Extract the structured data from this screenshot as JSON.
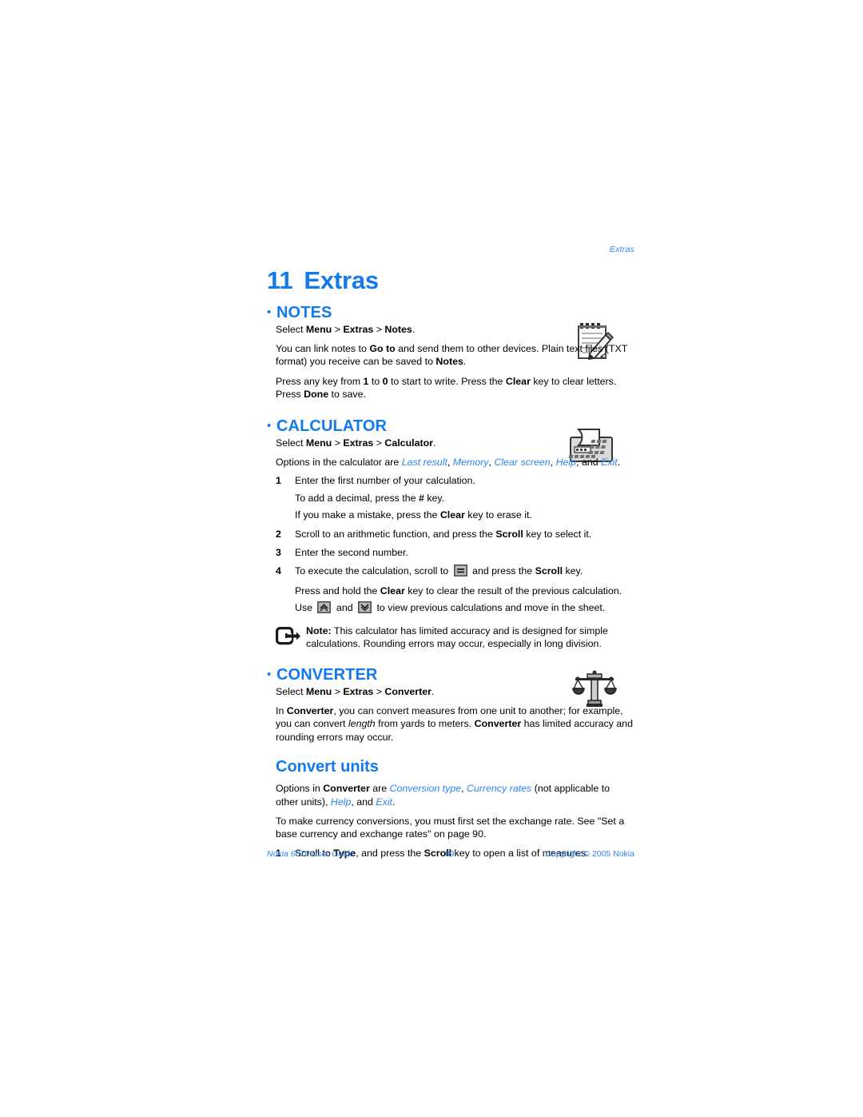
{
  "page": {
    "running_head": "Extras",
    "chapter_number": "11",
    "chapter_title": "Extras",
    "accent_color": "#1279ee",
    "link_color": "#2e86f0"
  },
  "notes": {
    "heading": "NOTES",
    "icon": "notepad-pencil-icon",
    "select_path_prefix": "Select ",
    "select_menu": "Menu",
    "sep1": " > ",
    "select_extras": "Extras",
    "sep2": " > ",
    "select_leaf": "Notes",
    "select_period": ".",
    "para1_a": "You can link notes to ",
    "para1_b": "Go to",
    "para1_c": " and send them to other devices. Plain text files (TXT format) you receive can be saved to ",
    "para1_d": "Notes",
    "para1_e": ".",
    "para2_a": "Press any key from ",
    "para2_b": "1",
    "para2_c": " to ",
    "para2_d": "0",
    "para2_e": " to start to write. Press the ",
    "para2_f": "Clear",
    "para2_g": " key to clear letters. Press ",
    "para2_h": "Done",
    "para2_i": " to save."
  },
  "calculator": {
    "heading": "CALCULATOR",
    "icon": "calculator-adding-machine-icon",
    "select_path_prefix": "Select ",
    "select_menu": "Menu",
    "sep1": " > ",
    "select_extras": "Extras",
    "sep2": " > ",
    "select_leaf": "Calculator",
    "select_period": ".",
    "options_lead": "Options in the calculator are ",
    "options": [
      "Last result",
      "Memory",
      "Clear screen",
      "Help",
      "Exit"
    ],
    "options_comma": ", ",
    "options_and": ", and ",
    "options_period": ".",
    "steps": [
      {
        "n": "1",
        "text": "Enter the first number of your calculation.",
        "subs": [
          {
            "a": "To add a decimal, press the ",
            "b": "#",
            "c": " key."
          },
          {
            "a": "If you make a mistake, press the ",
            "b": "Clear",
            "c": " key to erase it."
          }
        ]
      },
      {
        "n": "2",
        "a": "Scroll to an arithmetic function, and press the ",
        "b": "Scroll",
        "c": " key to select it."
      },
      {
        "n": "3",
        "text": "Enter the second number."
      },
      {
        "n": "4",
        "a": "To execute the calculation, scroll to ",
        "icon": "equals-key-icon",
        "b": " and press the ",
        "c": "Scroll",
        "d": " key."
      }
    ],
    "after_a": "Press and hold the ",
    "after_b": "Clear",
    "after_c": " key to clear the result of the previous calculation.",
    "use_a": "Use ",
    "use_icon_up": "scroll-up-key-icon",
    "use_and": " and ",
    "use_icon_down": "scroll-down-key-icon",
    "use_b": " to view previous calculations and move in the sheet.",
    "note_icon": "note-callout-icon",
    "note_label": "Note:",
    "note_text": " This calculator has limited accuracy and is designed for simple calculations. Rounding errors may occur, especially in long division."
  },
  "converter": {
    "heading": "CONVERTER",
    "icon": "balance-scale-icon",
    "select_path_prefix": "Select ",
    "select_menu": "Menu",
    "sep1": " > ",
    "select_extras": "Extras",
    "sep2": " > ",
    "select_leaf": "Converter",
    "select_period": ".",
    "para1_a": "In ",
    "para1_b": "Converter",
    "para1_c": ", you can convert measures from one unit to another; for example, you can convert ",
    "para1_d": "length",
    "para1_e": " from yards to meters. ",
    "para1_f": "Converter",
    "para1_g": " has limited accuracy and rounding errors may occur.",
    "subheading": "Convert units",
    "options_lead_a": "Options in ",
    "options_lead_b": "Converter",
    "options_lead_c": " are ",
    "opt1": "Conversion type",
    "opt_comma": ", ",
    "opt2": "Currency rates",
    "opt_paren": " (not applicable to other units), ",
    "opt3": "Help",
    "opt_and": ", and ",
    "opt4": "Exit",
    "opt_period": ".",
    "currency_para": "To make currency conversions, you must first set the exchange rate. See \"Set a base currency and exchange rates\" on page 90.",
    "step1_n": "1",
    "step1_a": "Scroll to ",
    "step1_b": "Type",
    "step1_c": ", and press the ",
    "step1_d": "Scroll",
    "step1_e": " key to open a list of measures."
  },
  "footer": {
    "left": "Nokia 6670 User Guide",
    "center": "89",
    "right": "Copyright © 2005 Nokia"
  }
}
